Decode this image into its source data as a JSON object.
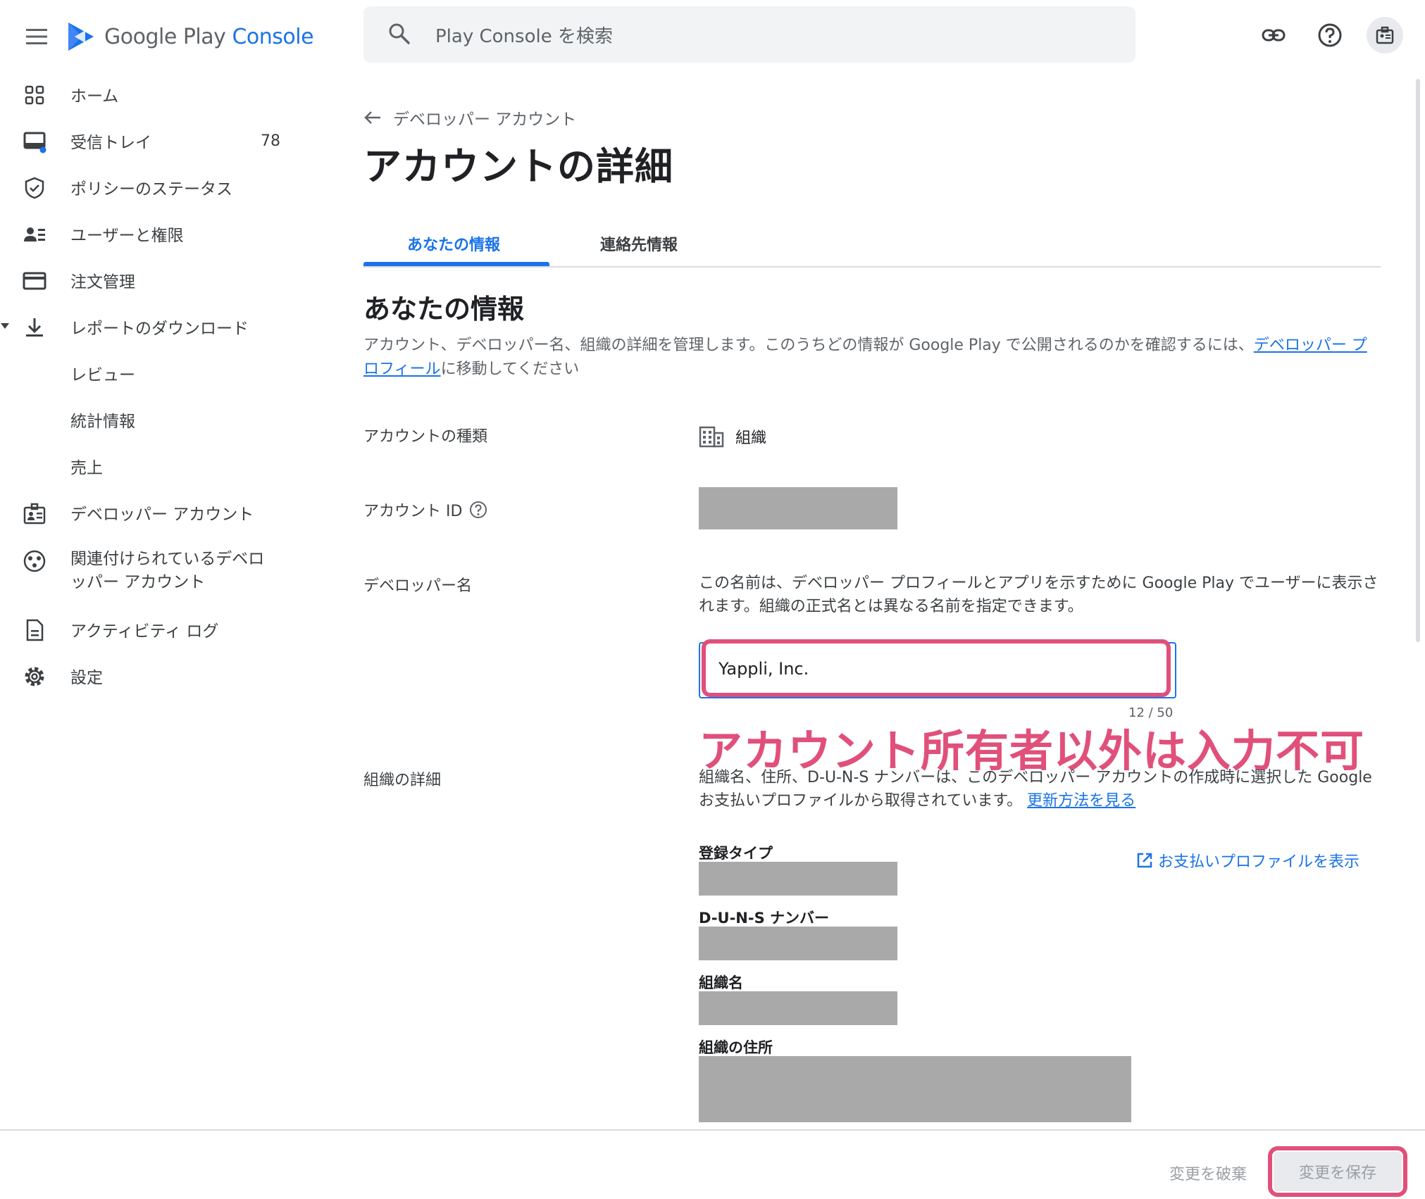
{
  "header": {
    "logo_google_play": "Google Play ",
    "logo_console": "Console",
    "search_placeholder": "Play Console を検索"
  },
  "sidebar": {
    "items": [
      {
        "label": "ホーム",
        "icon": "grid-icon"
      },
      {
        "label": "受信トレイ",
        "icon": "inbox-icon",
        "count": "78"
      },
      {
        "label": "ポリシーのステータス",
        "icon": "shield-icon"
      },
      {
        "label": "ユーザーと権限",
        "icon": "users-icon"
      },
      {
        "label": "注文管理",
        "icon": "credit-card-icon"
      },
      {
        "label": "レポートのダウンロード",
        "icon": "download-icon"
      },
      {
        "label": "レビュー"
      },
      {
        "label": "統計情報"
      },
      {
        "label": "売上"
      },
      {
        "label": "デベロッパー アカウント",
        "icon": "badge-icon"
      },
      {
        "label_line1": "関連付けられているデベロ",
        "label_line2": "ッパー アカウント",
        "icon": "linked-accounts-icon"
      },
      {
        "label": "アクティビティ ログ",
        "icon": "document-icon"
      },
      {
        "label": "設定",
        "icon": "gear-icon"
      }
    ]
  },
  "main": {
    "breadcrumb": "デベロッパー アカウント",
    "title": "アカウントの詳細",
    "tabs": [
      {
        "label": "あなたの情報",
        "active": true
      },
      {
        "label": "連絡先情報",
        "active": false
      }
    ],
    "section_title": "あなたの情報",
    "description_before_link": "アカウント、デベロッパー名、組織の詳細を管理します。このうちどの情報が Google Play で公開されるのかを確認するには、",
    "description_link": "デベロッパー プロフィール",
    "description_after_link": "に移動してください",
    "account_type_label": "アカウントの種類",
    "account_type_value": "組織",
    "account_id_label": "アカウント ID",
    "developer_name_label": "デベロッパー名",
    "developer_name_help": "この名前は、デベロッパー プロフィールとアプリを示すために Google Play でユーザーに表示されます。組織の正式名とは異なる名前を指定できます。",
    "developer_name_value": "Yappli, Inc.",
    "developer_name_counter": "12 / 50",
    "annotation": "アカウント所有者以外は入力不可",
    "org_details_label": "組織の詳細",
    "org_details_help": "組織名、住所、D-U-N-S ナンバーは、このデベロッパー アカウントの作成時に選択した Google お支払いプロファイルから取得されています。",
    "org_details_link": "更新方法を見る",
    "payments_profile_link": "お支払いプロファイルを表示",
    "registration_type_label": "登録タイプ",
    "duns_label": "D-U-N-S ナンバー",
    "org_name_label": "組織名",
    "org_address_label": "組織の住所"
  },
  "footer": {
    "discard_label": "変更を破棄",
    "save_label": "変更を保存"
  },
  "colors": {
    "accent": "#1a73e8",
    "annotation": "#e0507a",
    "redaction": "#a9a9a9"
  }
}
